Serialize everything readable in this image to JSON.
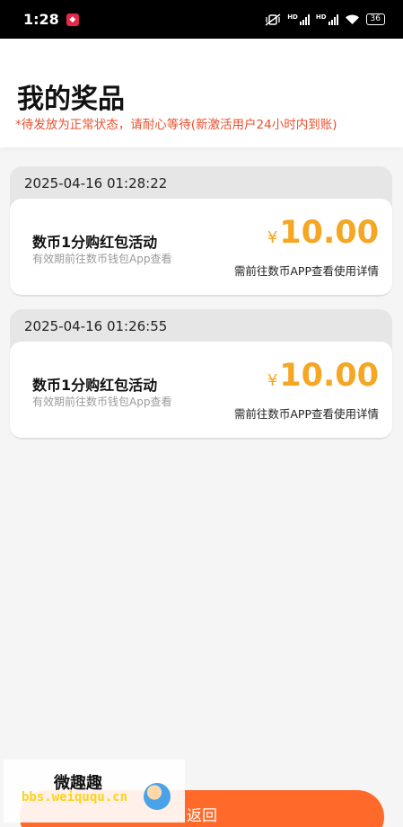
{
  "status_bar": {
    "time": "1:28",
    "battery": "36"
  },
  "header": {
    "title": "我的奖品",
    "notice": "*待发放为正常状态，请耐心等待(新激活用户24小时内到账)"
  },
  "prizes": [
    {
      "date": "2025-04-16 01:28:22",
      "name": "数币1分购红包活动",
      "validity": "有效期前往数币钱包App查看",
      "currency": "¥",
      "amount": "10.00",
      "note": "需前往数币APP查看使用详情"
    },
    {
      "date": "2025-04-16 01:26:55",
      "name": "数币1分购红包活动",
      "validity": "有效期前往数币钱包App查看",
      "currency": "¥",
      "amount": "10.00",
      "note": "需前往数币APP查看使用详情"
    }
  ],
  "footer": {
    "back_label": "返回"
  },
  "watermark": {
    "name": "微趣趣",
    "url": "bbs.weiququ.cn"
  },
  "colors": {
    "accent": "#ff6a2b",
    "amount": "#f5a623",
    "notice": "#e8512f"
  }
}
